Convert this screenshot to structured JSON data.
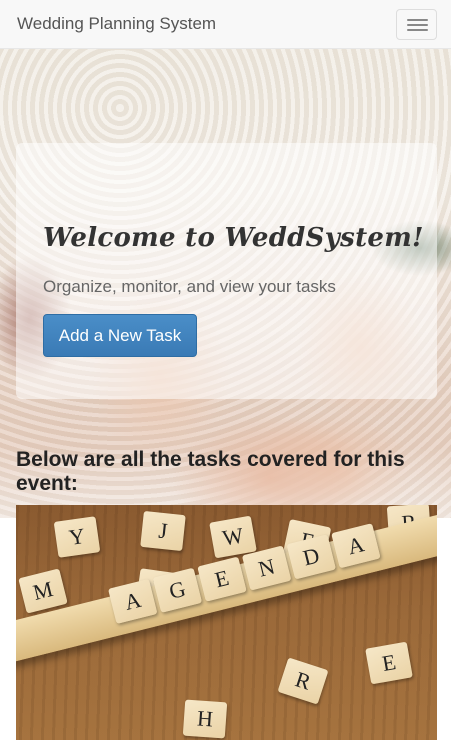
{
  "navbar": {
    "brand": "Wedding Planning System",
    "menu_icon": "hamburger-icon"
  },
  "hero": {
    "welcome": "Welcome to WeddSystem!",
    "subtitle": "Organize, monitor, and view your tasks",
    "add_button": "Add a New Task"
  },
  "tasks": {
    "heading": "Below are all the tasks covered for this event:"
  },
  "agenda_image": {
    "rack_tiles": [
      "A",
      "G",
      "E",
      "N",
      "D",
      "A"
    ],
    "scattered_tiles": [
      "Y",
      "J",
      "W",
      "F",
      "R",
      "M",
      "E",
      "R",
      "H",
      "B"
    ]
  },
  "colors": {
    "button": "#3a7ab5",
    "navbar": "#f8f8f8"
  }
}
